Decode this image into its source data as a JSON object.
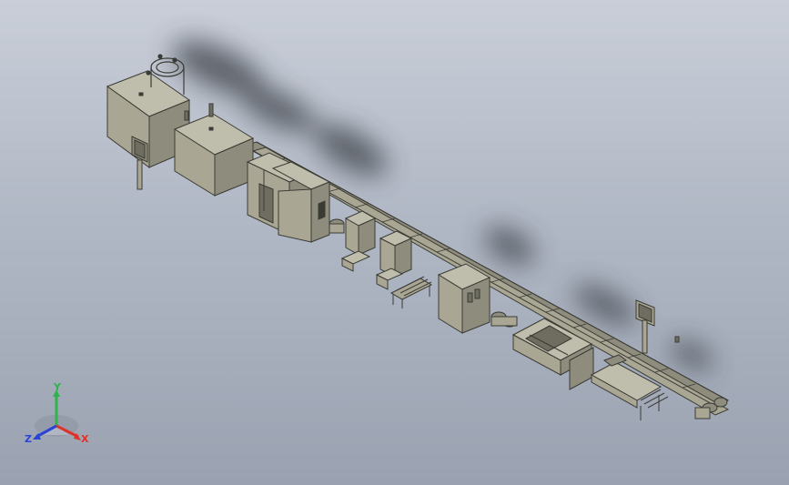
{
  "app": {
    "view": "isometric-3d-assembly"
  },
  "colors": {
    "background_top": "#c9ced8",
    "background_bottom": "#9aa2b1",
    "machine_body": "#a9a793",
    "machine_dark": "#6f6d60",
    "edge": "#3b3b36",
    "x_axis": "#e0322a",
    "y_axis": "#2fb34a",
    "z_axis": "#2a45d6"
  },
  "triad": {
    "x_label": "X",
    "y_label": "Y",
    "z_label": "Z"
  }
}
